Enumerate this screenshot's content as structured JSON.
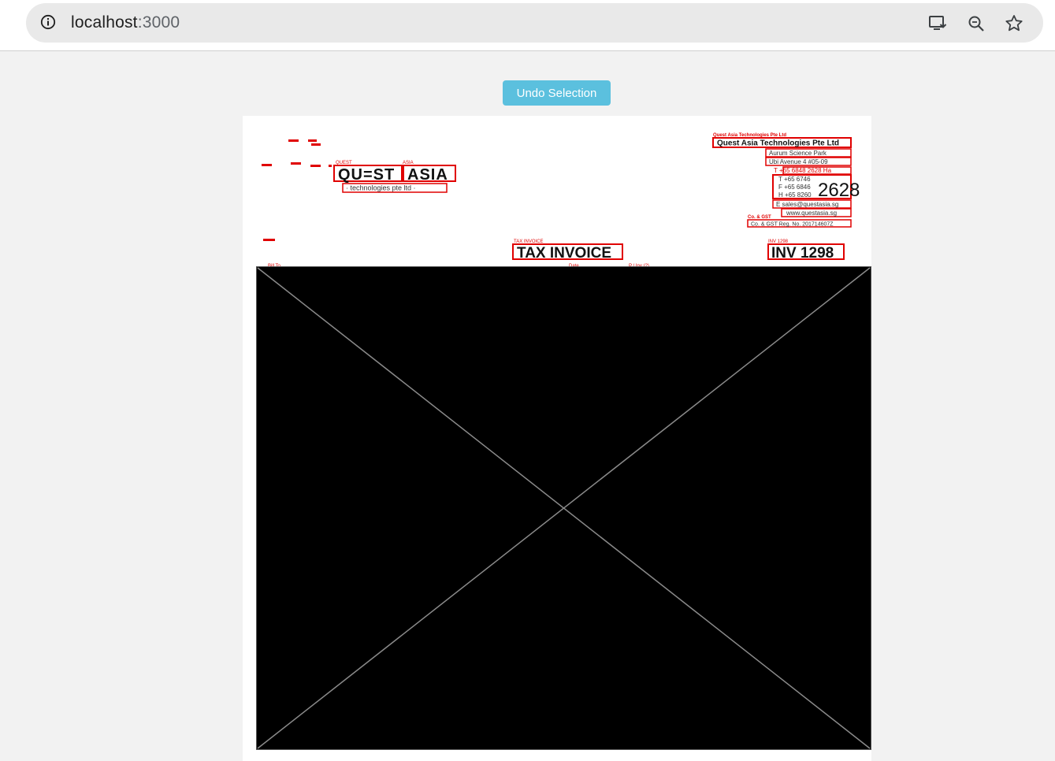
{
  "browser": {
    "url_host": "localhost",
    "url_port": ":3000",
    "icons": [
      "info-icon",
      "install-app-icon",
      "zoom-icon",
      "bookmark-star-icon"
    ]
  },
  "toolbar": {
    "undo_label": "Undo Selection"
  },
  "colors": {
    "annotation": "#e00000",
    "button": "#5bc0de",
    "placeholder": "#000000"
  },
  "document": {
    "logo": {
      "word1_tag": "QUEST",
      "word2_tag": "ASIA",
      "word1": "QU=ST",
      "word2": "ASIA",
      "tagline": "· technologies pte ltd ·"
    },
    "company": {
      "name_tag": "Quest Asia Technologies Pte Ltd",
      "name": "Quest Asia Technologies Pte Ltd",
      "addr1": "Aurum Science Park",
      "addr2": "Ubi Avenue 4 #05-09",
      "phone_t": "T +65 6848 2628 Ha",
      "phone_t_tag": "2628 H",
      "t_line": "T +65 6746",
      "f_line": "F +65 6846",
      "h_line": "H +65 8260",
      "big_num": "2628",
      "email": "E sales@questasia.sg",
      "web": "www.questasia.sg",
      "reg_tag": "Co. & GST",
      "reg": "Co. & GST Reg. No. 201714607Z"
    },
    "title_tag": "TAX INVOICE",
    "title": "TAX INVOICE",
    "inv_tag": "INV 1298",
    "inv": "INV 1298",
    "partial_labels": [
      "Bill To",
      "Date",
      "P / Inv (2)"
    ]
  }
}
